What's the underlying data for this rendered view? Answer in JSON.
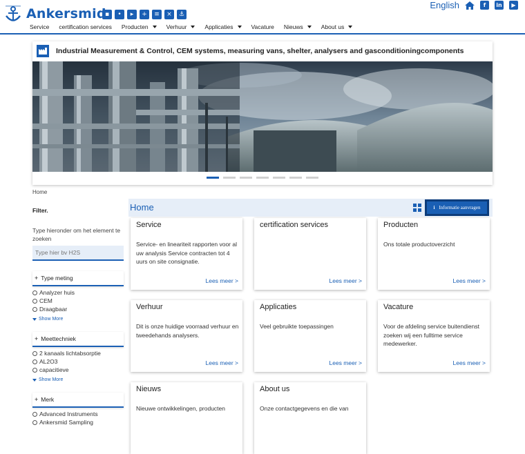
{
  "brand": {
    "name": "Ankersmid",
    "color": "#1a5fb4"
  },
  "quick_icons": [
    "folder-icon",
    "person-icon",
    "truck-icon",
    "plus-icon",
    "list-icon",
    "tools-icon",
    "anchor-icon"
  ],
  "top_bar": {
    "language": "English",
    "icons": [
      "home-icon",
      "facebook-icon",
      "linkedin-icon",
      "youtube-icon"
    ]
  },
  "nav": [
    {
      "label": "Service",
      "dropdown": false
    },
    {
      "label": "certification services",
      "dropdown": false
    },
    {
      "label": "Producten",
      "dropdown": true
    },
    {
      "label": "Verhuur",
      "dropdown": true
    },
    {
      "label": "Applicaties",
      "dropdown": true
    },
    {
      "label": "Vacature",
      "dropdown": false
    },
    {
      "label": "Nieuws",
      "dropdown": true
    },
    {
      "label": "About us",
      "dropdown": true
    }
  ],
  "hero": {
    "title": "Industrial Measurement & Control, CEM systems, measuring vans, shelter, analysers and gasconditioningcomponents",
    "slides": 7,
    "active_slide": 1
  },
  "breadcrumb": "Home",
  "sidebar": {
    "filter_title": "Filter.",
    "hint": "Type hieronder om het element te zoeken",
    "search_placeholder": "Type hier bv H2S",
    "groups": [
      {
        "label": "Type meting",
        "options": [
          "Analyzer huis",
          "CEM",
          "Draagbaar"
        ],
        "show_more": "Show More"
      },
      {
        "label": "Meettechniek",
        "options": [
          "2 kanaals lichtabsorptie",
          "AL2O3",
          "capacitieve"
        ],
        "show_more": "Show More"
      },
      {
        "label": "Merk",
        "options": [
          "Advanced Instruments",
          "Ankersmid Sampling"
        ],
        "show_more": ""
      }
    ]
  },
  "main": {
    "title": "Home",
    "info_button": "Informatie aanvragen",
    "cards": [
      {
        "title": "Service",
        "desc": "Service- en lineariteit rapporten voor al uw analysis Service contracten tot 4 uurs on site consignatie.",
        "more": "Lees meer >"
      },
      {
        "title": "certification services",
        "desc": "",
        "more": "Lees meer >"
      },
      {
        "title": "Producten",
        "desc": "Ons totale productoverzicht",
        "more": "Lees meer >"
      },
      {
        "title": "Verhuur",
        "desc": "Dit is onze huidige voorraad verhuur en tweedehands analysers.",
        "more": "Lees meer >"
      },
      {
        "title": "Applicaties",
        "desc": "Veel gebruikte toepassingen",
        "more": "Lees meer >"
      },
      {
        "title": "Vacature",
        "desc": "Voor de afdeling service buitendienst zoeken wij een fulltime service medewerker.",
        "more": "Lees meer >"
      },
      {
        "title": "Nieuws",
        "desc": "Nieuwe ontwikkelingen, producten",
        "more": ""
      },
      {
        "title": "About us",
        "desc": "Onze contactgegevens en die van",
        "more": ""
      }
    ]
  }
}
